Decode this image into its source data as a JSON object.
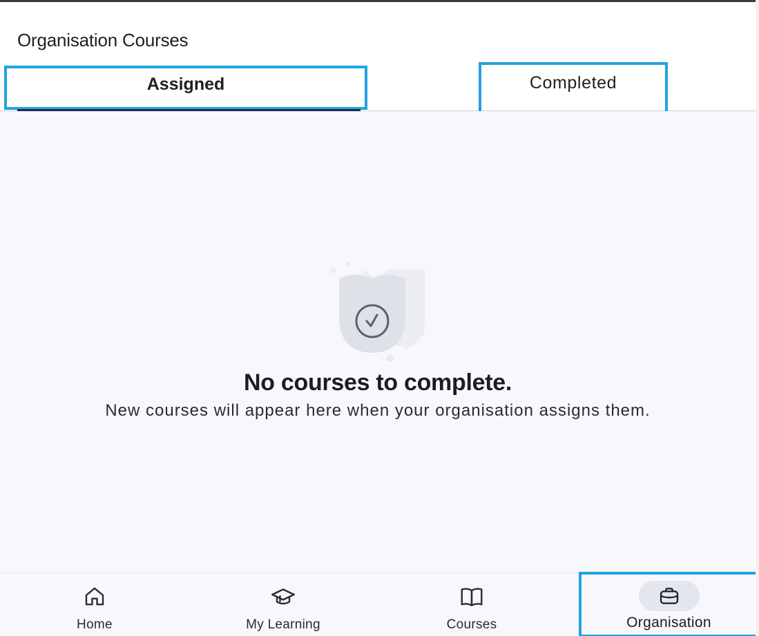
{
  "header": {
    "title": "Organisation Courses"
  },
  "tabs": [
    {
      "label": "Assigned",
      "selected": true
    },
    {
      "label": "Completed",
      "selected": false
    }
  ],
  "empty_state": {
    "icon": "shield-check-icon",
    "title": "No courses to complete.",
    "subtitle": "New courses will appear here when your organisation assigns them."
  },
  "bottom_nav": {
    "items": [
      {
        "label": "Home",
        "icon": "home-icon"
      },
      {
        "label": "My Learning",
        "icon": "graduation-cap-icon"
      },
      {
        "label": "Courses",
        "icon": "open-book-icon"
      },
      {
        "label": "Organisation",
        "icon": "briefcase-icon",
        "selected": true
      }
    ]
  },
  "colors": {
    "highlight_border": "#1ea3e2",
    "tab_indicator": "#1f2a44",
    "content_background": "#f8f8fc"
  }
}
